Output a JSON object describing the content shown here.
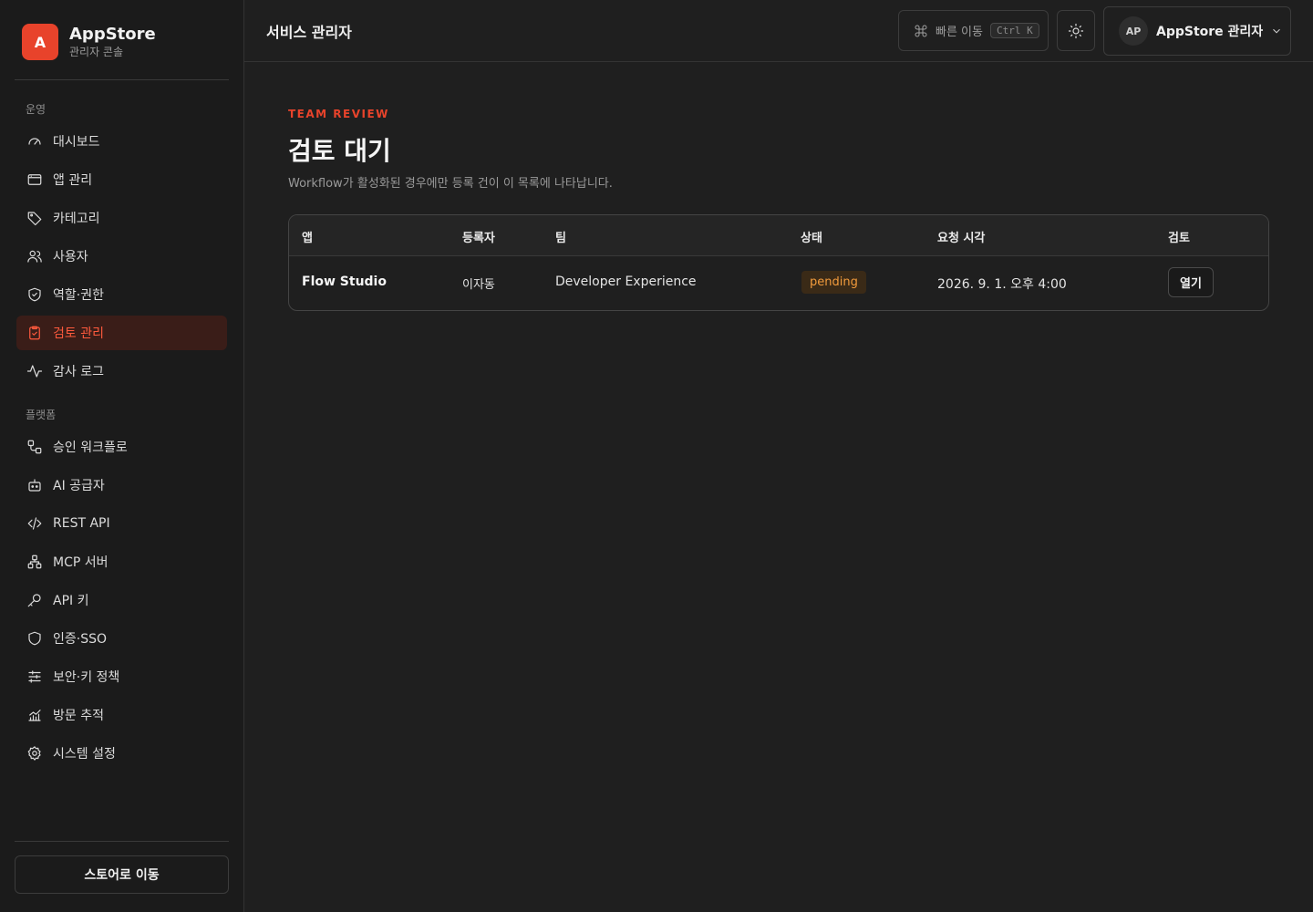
{
  "brand": {
    "logo_letter": "A",
    "name": "AppStore",
    "subtitle": "관리자 콘솔"
  },
  "sidebar": {
    "section_ops": "운영",
    "section_platform": "플랫폼",
    "items": [
      {
        "label": "대시보드",
        "icon": "gauge-icon"
      },
      {
        "label": "앱 관리",
        "icon": "window-icon"
      },
      {
        "label": "카테고리",
        "icon": "tag-icon"
      },
      {
        "label": "사용자",
        "icon": "users-icon"
      },
      {
        "label": "역할·권한",
        "icon": "shield-check-icon"
      },
      {
        "label": "검토 관리",
        "icon": "clipboard-check-icon",
        "active": true
      },
      {
        "label": "감사 로그",
        "icon": "activity-icon"
      },
      {
        "label": "승인 워크플로",
        "icon": "workflow-icon"
      },
      {
        "label": "AI 공급자",
        "icon": "bot-icon"
      },
      {
        "label": "REST API",
        "icon": "code-icon"
      },
      {
        "label": "MCP 서버",
        "icon": "network-icon"
      },
      {
        "label": "API 키",
        "icon": "key-icon"
      },
      {
        "label": "인증·SSO",
        "icon": "shield-icon"
      },
      {
        "label": "보안·키 정책",
        "icon": "sliders-icon"
      },
      {
        "label": "방문 추적",
        "icon": "chart-icon"
      },
      {
        "label": "시스템 설정",
        "icon": "gear-icon"
      }
    ],
    "store_button": "스토어로 이동"
  },
  "topbar": {
    "title": "서비스 관리자",
    "quick_nav": "빠른 이동",
    "shortcut": "Ctrl K",
    "avatar_initials": "AP",
    "user_name": "AppStore 관리자"
  },
  "main": {
    "eyebrow": "TEAM REVIEW",
    "title": "검토 대기",
    "description": "Workflow가 활성화된 경우에만 등록 건이 이 목록에 나타납니다.",
    "table": {
      "headers": [
        "앱",
        "등록자",
        "팀",
        "상태",
        "요청 시각",
        "검토"
      ],
      "rows": [
        {
          "app": "Flow Studio",
          "registrant": "이자동",
          "team": "Developer Experience",
          "status": "pending",
          "requested_at": "2026. 9. 1. 오후 4:00",
          "action": "열기"
        }
      ]
    }
  },
  "colors": {
    "accent": "#e8432b",
    "pending": "#f29b3c",
    "background": "#1f1f1f"
  }
}
